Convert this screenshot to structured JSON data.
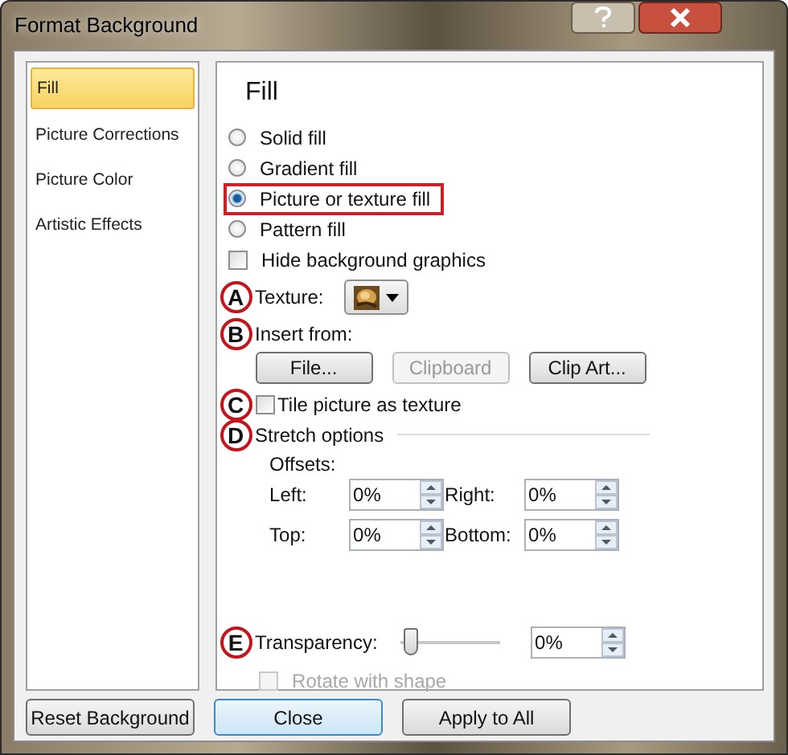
{
  "window": {
    "title": "Format Background"
  },
  "sidebar": {
    "items": [
      {
        "label": "Fill",
        "selected": true
      },
      {
        "label": "Picture Corrections",
        "selected": false
      },
      {
        "label": "Picture Color",
        "selected": false
      },
      {
        "label": "Artistic Effects",
        "selected": false
      }
    ]
  },
  "panel": {
    "heading": "Fill",
    "fill_options": [
      {
        "label": "Solid fill",
        "selected": false,
        "highlighted": false
      },
      {
        "label": "Gradient fill",
        "selected": false,
        "highlighted": false
      },
      {
        "label": "Picture or texture fill",
        "selected": true,
        "highlighted": true
      },
      {
        "label": "Pattern fill",
        "selected": false,
        "highlighted": false
      }
    ],
    "hide_background": {
      "label": "Hide background graphics",
      "checked": false
    },
    "texture": {
      "marker": "A",
      "label": "Texture:"
    },
    "insert_from": {
      "marker": "B",
      "label": "Insert from:",
      "buttons": [
        {
          "label": "File...",
          "disabled": false
        },
        {
          "label": "Clipboard",
          "disabled": true
        },
        {
          "label": "Clip Art...",
          "disabled": false
        }
      ]
    },
    "tile": {
      "marker": "C",
      "label": "Tile picture as texture",
      "checked": false
    },
    "stretch": {
      "marker": "D",
      "label": "Stretch options",
      "offsets_label": "Offsets:",
      "offsets": [
        {
          "label": "Left:",
          "value": "0%"
        },
        {
          "label": "Right:",
          "value": "0%"
        },
        {
          "label": "Top:",
          "value": "0%"
        },
        {
          "label": "Bottom:",
          "value": "0%"
        }
      ]
    },
    "transparency": {
      "marker": "E",
      "label": "Transparency:",
      "level": 0,
      "value": "0%"
    },
    "rotate": {
      "label": "Rotate with shape",
      "checked": false,
      "disabled": true
    }
  },
  "footer_buttons": [
    {
      "label": "Reset Background",
      "default": false
    },
    {
      "label": "Close",
      "default": true
    },
    {
      "label": "Apply to All",
      "default": false
    }
  ]
}
